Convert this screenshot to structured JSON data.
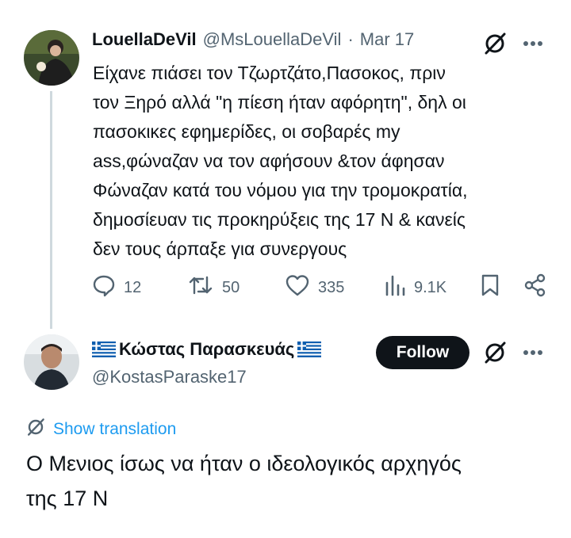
{
  "tweet": {
    "display_name": "LouellaDeVil",
    "handle": "@MsLouellaDeVil",
    "separator": "·",
    "date": "Mar 17",
    "text_lines": [
      "Είχανε πιάσει τον Τζωρτζάτο,Πασοκος, πριν",
      "τον Ξηρό αλλά \"η πίεση ήταν αφόρητη\", δηλ οι",
      "πασοκικες εφημερίδες, οι σοβαρές my",
      "ass,φώναζαν να τον αφήσουν &τον άφησαν",
      "Φώναζαν κατά του νόμου για την τρομοκρατία,",
      "δημοσίευαν τις προκηρύξεις της 17 Ν & κανείς",
      "δεν τους άρπαξε για συνεργους"
    ],
    "actions": {
      "replies": "12",
      "reposts": "50",
      "likes": "335",
      "views": "9.1K"
    }
  },
  "reply": {
    "display_name": "Κώστας Παρασκευάς",
    "handle": "@KostasParaske17",
    "follow_label": "Follow",
    "show_translation": "Show translation",
    "text_lines": [
      "Ο Μενιος ίσως να ήταν ο ιδεολογικός αρχηγός",
      "της 17 Ν"
    ]
  },
  "icons": {
    "grok": "grok-icon",
    "more": "more-icon",
    "reply": "reply-icon",
    "repost": "repost-icon",
    "like": "heart-icon",
    "views": "views-icon",
    "bookmark": "bookmark-icon",
    "share": "share-icon",
    "flag": "greek-flag-icon"
  },
  "colors": {
    "text": "#0f1419",
    "muted": "#536471",
    "link": "#1d9bf0",
    "follow_bg": "#0f1419",
    "thread_line": "#cfd9de"
  }
}
